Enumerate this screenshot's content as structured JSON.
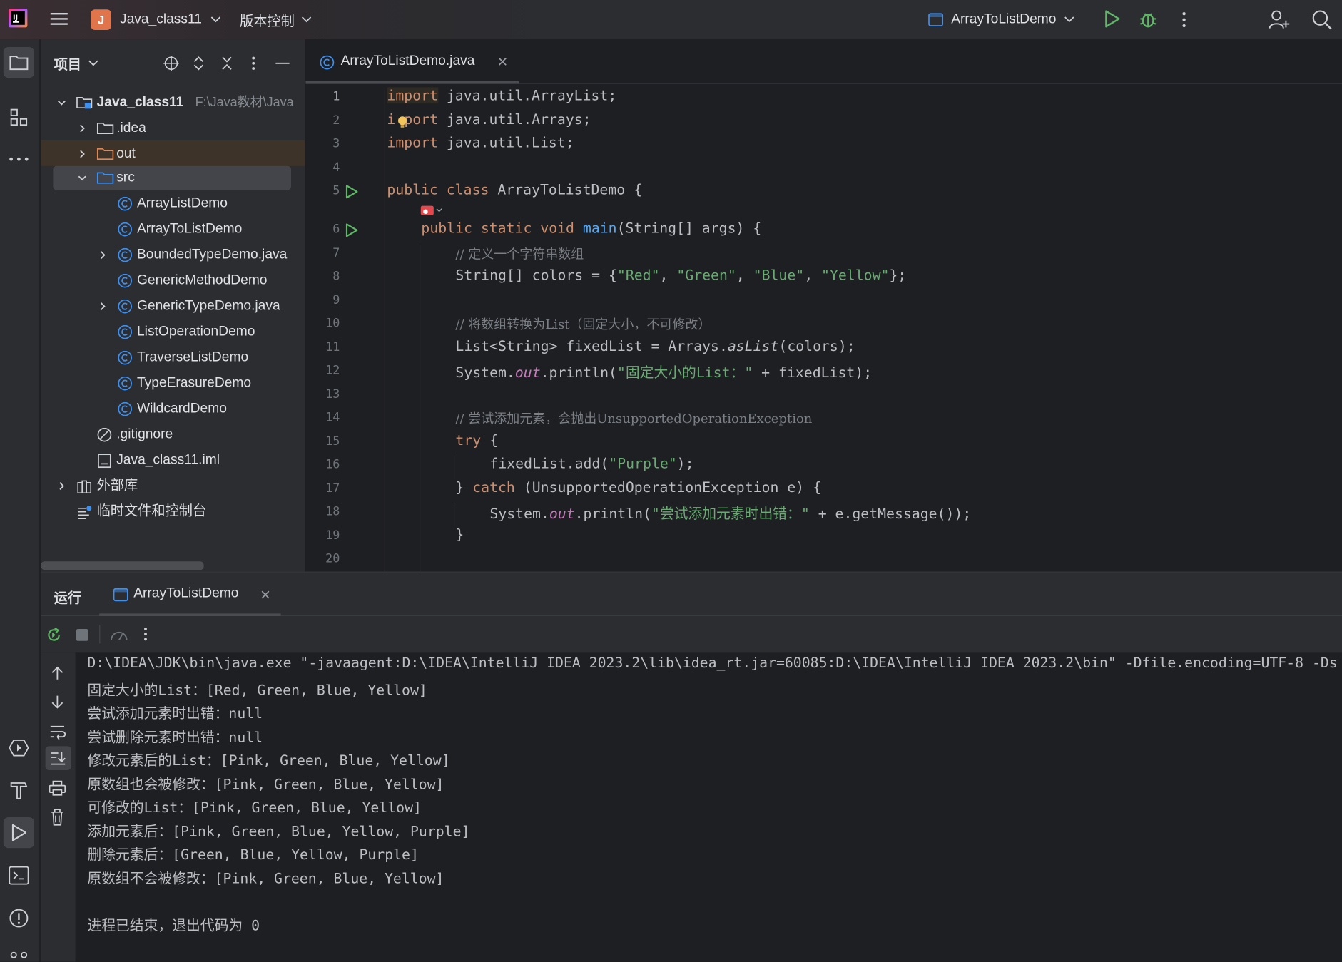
{
  "topbar": {
    "project_badge": "J",
    "project_name": "Java_class11",
    "vcs_label": "版本控制",
    "run_config": "ArrayToListDemo"
  },
  "project_panel": {
    "title": "项目",
    "root": {
      "name": "Java_class11",
      "path": "F:\\Java教材\\Java"
    },
    "items": [
      {
        "label": ".idea",
        "type": "folder"
      },
      {
        "label": "out",
        "type": "folder-excluded"
      },
      {
        "label": "src",
        "type": "source-folder"
      },
      {
        "label": "ArrayListDemo",
        "type": "class"
      },
      {
        "label": "ArrayToListDemo",
        "type": "class"
      },
      {
        "label": "BoundedTypeDemo.java",
        "type": "class-file"
      },
      {
        "label": "GenericMethodDemo",
        "type": "class"
      },
      {
        "label": "GenericTypeDemo.java",
        "type": "class-file"
      },
      {
        "label": "ListOperationDemo",
        "type": "class"
      },
      {
        "label": "TraverseListDemo",
        "type": "class"
      },
      {
        "label": "TypeErasureDemo",
        "type": "class"
      },
      {
        "label": "WildcardDemo",
        "type": "class"
      },
      {
        "label": ".gitignore",
        "type": "ignore"
      },
      {
        "label": "Java_class11.iml",
        "type": "iml"
      },
      {
        "label": "外部库",
        "type": "library"
      },
      {
        "label": "临时文件和控制台",
        "type": "scratches"
      }
    ]
  },
  "editor": {
    "tab": "ArrayToListDemo.java",
    "line_numbers": [
      "1",
      "2",
      "3",
      "4",
      "5",
      "6",
      "7",
      "8",
      "9",
      "10",
      "11",
      "12",
      "13",
      "14",
      "15",
      "16",
      "17",
      "18",
      "19",
      "20"
    ],
    "code": {
      "l1_kw": "import",
      "l1_rest": " java.util.ArrayList;",
      "l2_kw_a": "i",
      "l2_kw_b": "port",
      "l2_rest": " java.util.Arrays;",
      "l3_kw": "import",
      "l3_rest": " java.util.List;",
      "l5_kw": "public class",
      "l5_rest": " ArrayToListDemo {",
      "l6_kw": "public static void",
      "l6_fn": "main",
      "l6_rest": "(String[] args) {",
      "l7_cmt": "// 定义一个字符串数组",
      "l8_a": "String[] colors = {",
      "l8_s1": "\"Red\"",
      "l8_c1": ", ",
      "l8_s2": "\"Green\"",
      "l8_c2": ", ",
      "l8_s3": "\"Blue\"",
      "l8_c3": ", ",
      "l8_s4": "\"Yellow\"",
      "l8_end": "};",
      "l10_cmt": "// 将数组转换为List（固定大小，不可修改）",
      "l11_a": "List<String> fixedList = Arrays.",
      "l11_it": "asList",
      "l11_end": "(colors);",
      "l12_a": "System.",
      "l12_fld": "out",
      "l12_b": ".println(",
      "l12_str": "\"固定大小的List：\"",
      "l12_end": " + fixedList);",
      "l14_cmt": "// 尝试添加元素，会抛出UnsupportedOperationException",
      "l15_kw": "try",
      "l15_end": " {",
      "l16_a": "fixedList.add(",
      "l16_str": "\"Purple\"",
      "l16_end": ");",
      "l17_a": "} ",
      "l17_kw": "catch",
      "l17_end": " (UnsupportedOperationException e) {",
      "l18_a": "System.",
      "l18_fld": "out",
      "l18_b": ".println(",
      "l18_str": "\"尝试添加元素时出错：\"",
      "l18_end": " + e.getMessage());",
      "l19": "}"
    }
  },
  "run_panel": {
    "title": "运行",
    "tab": "ArrayToListDemo",
    "console": [
      "D:\\IDEA\\JDK\\bin\\java.exe \"-javaagent:D:\\IDEA\\IntelliJ IDEA 2023.2\\lib\\idea_rt.jar=60085:D:\\IDEA\\IntelliJ IDEA 2023.2\\bin\" -Dfile.encoding=UTF-8 -Ds",
      "固定大小的List：[Red, Green, Blue, Yellow]",
      "尝试添加元素时出错：null",
      "尝试删除元素时出错：null",
      "修改元素后的List：[Pink, Green, Blue, Yellow]",
      "原数组也会被修改：[Pink, Green, Blue, Yellow]",
      "可修改的List：[Pink, Green, Blue, Yellow]",
      "添加元素后：[Pink, Green, Blue, Yellow, Purple]",
      "删除元素后：[Green, Blue, Yellow, Purple]",
      "原数组不会被修改：[Pink, Green, Blue, Yellow]",
      "",
      "进程已结束，退出代码为 0"
    ]
  },
  "icons": {
    "app_logo": "intellij-logo-icon",
    "menu": "hamburger-icon",
    "run": "run-icon",
    "debug": "debug-icon",
    "more": "more-vertical-icon",
    "add_user": "add-user-icon",
    "search": "search-icon"
  },
  "colors": {
    "keyword": "#cf8e6d",
    "string": "#6aab73",
    "comment": "#7a7e85",
    "function": "#56a8f5",
    "static_field": "#c77dbb",
    "run_green": "#5fb865",
    "class_icon": "#3d8ff0"
  }
}
